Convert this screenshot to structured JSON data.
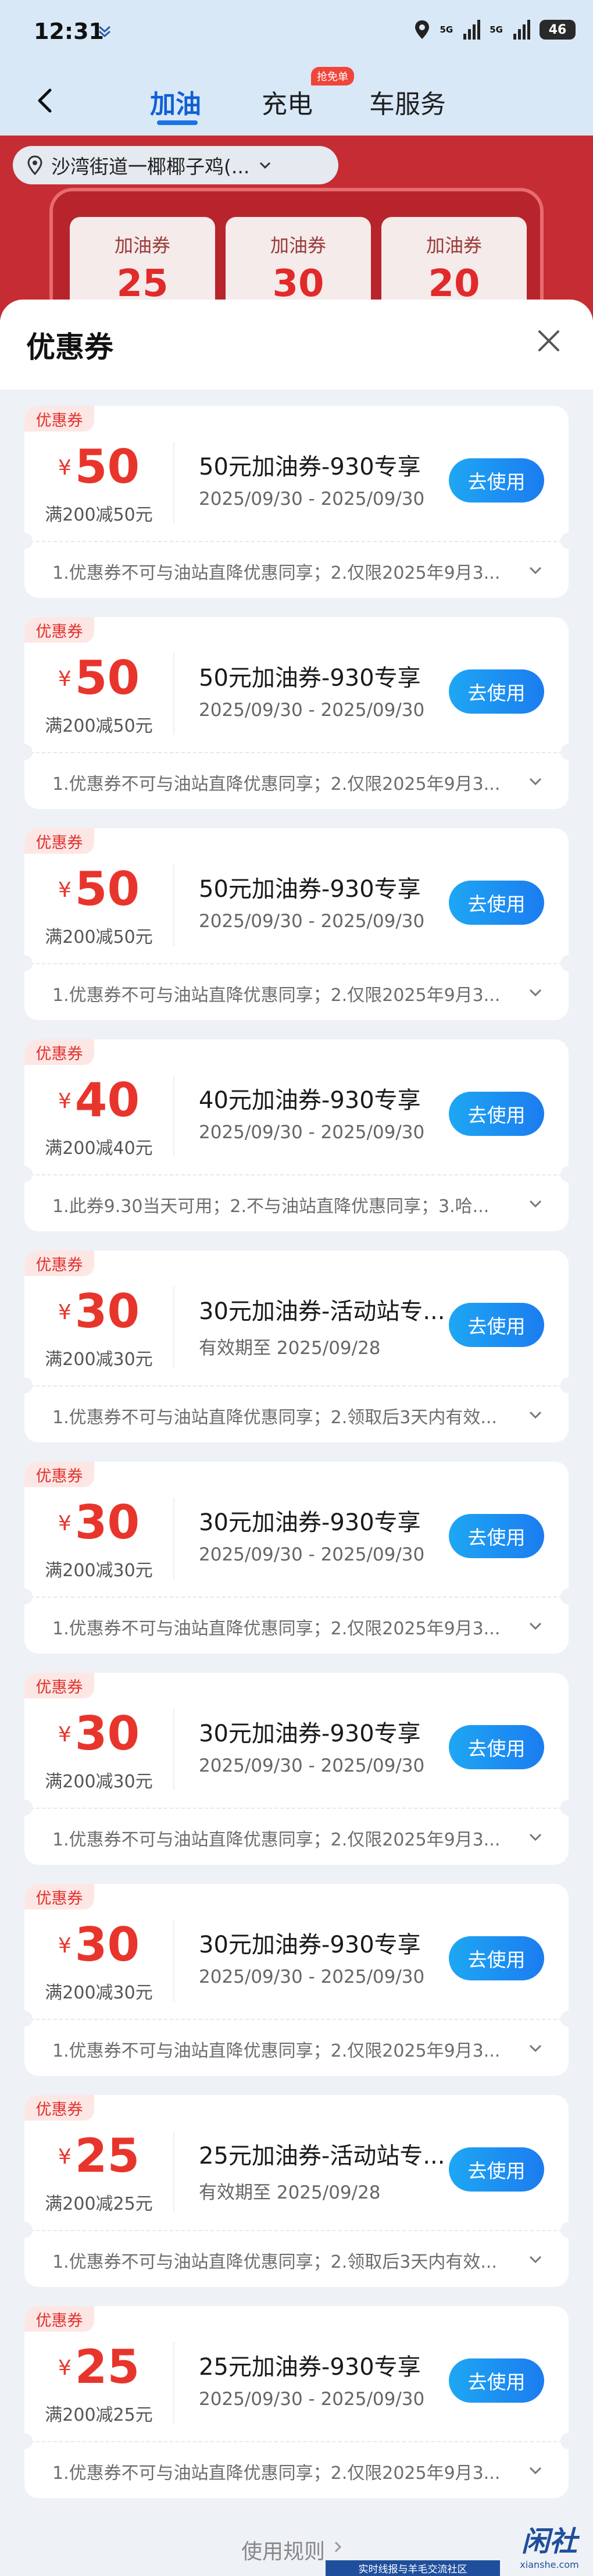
{
  "status_bar": {
    "time": "12:31",
    "signal_tag_1": "5G",
    "signal_tag_2": "5G",
    "battery": "46"
  },
  "nav": {
    "back_icon": "chevron-left-icon",
    "tabs": [
      {
        "label": "加油",
        "active": true
      },
      {
        "label": "充电",
        "badge": "抢免单"
      },
      {
        "label": "车服务"
      }
    ]
  },
  "hero": {
    "location": "沙湾街道一椰椰子鸡(...",
    "cards": [
      {
        "label": "加油券",
        "value": "25"
      },
      {
        "label": "加油券",
        "value": "30"
      },
      {
        "label": "加油券",
        "value": "20"
      }
    ]
  },
  "sheet": {
    "title": "优惠券",
    "close_icon": "close-icon"
  },
  "coupons": [
    {
      "tag": "优惠券",
      "currency": "¥",
      "amount": "50",
      "condition": "满200减50元",
      "title": "50元加油券-930专享",
      "date": "2025/09/30 - 2025/09/30",
      "button": "去使用",
      "rules": "1.优惠券不可与油站直降优惠同享；2.仅限2025年9月3..."
    },
    {
      "tag": "优惠券",
      "currency": "¥",
      "amount": "50",
      "condition": "满200减50元",
      "title": "50元加油券-930专享",
      "date": "2025/09/30 - 2025/09/30",
      "button": "去使用",
      "rules": "1.优惠券不可与油站直降优惠同享；2.仅限2025年9月3..."
    },
    {
      "tag": "优惠券",
      "currency": "¥",
      "amount": "50",
      "condition": "满200减50元",
      "title": "50元加油券-930专享",
      "date": "2025/09/30 - 2025/09/30",
      "button": "去使用",
      "rules": "1.优惠券不可与油站直降优惠同享；2.仅限2025年9月3..."
    },
    {
      "tag": "优惠券",
      "currency": "¥",
      "amount": "40",
      "condition": "满200减40元",
      "title": "40元加油券-930专享",
      "date": "2025/09/30 - 2025/09/30",
      "button": "去使用",
      "rules": "1.此券9.30当天可用；2.不与油站直降优惠同享；3.哈..."
    },
    {
      "tag": "优惠券",
      "currency": "¥",
      "amount": "30",
      "condition": "满200减30元",
      "title": "30元加油券-活动站专...",
      "date": "有效期至 2025/09/28",
      "button": "去使用",
      "rules": "1.优惠券不可与油站直降优惠同享；2.领取后3天内有效..."
    },
    {
      "tag": "优惠券",
      "currency": "¥",
      "amount": "30",
      "condition": "满200减30元",
      "title": "30元加油券-930专享",
      "date": "2025/09/30 - 2025/09/30",
      "button": "去使用",
      "rules": "1.优惠券不可与油站直降优惠同享；2.仅限2025年9月3..."
    },
    {
      "tag": "优惠券",
      "currency": "¥",
      "amount": "30",
      "condition": "满200减30元",
      "title": "30元加油券-930专享",
      "date": "2025/09/30 - 2025/09/30",
      "button": "去使用",
      "rules": "1.优惠券不可与油站直降优惠同享；2.仅限2025年9月3..."
    },
    {
      "tag": "优惠券",
      "currency": "¥",
      "amount": "30",
      "condition": "满200减30元",
      "title": "30元加油券-930专享",
      "date": "2025/09/30 - 2025/09/30",
      "button": "去使用",
      "rules": "1.优惠券不可与油站直降优惠同享；2.仅限2025年9月3..."
    },
    {
      "tag": "优惠券",
      "currency": "¥",
      "amount": "25",
      "condition": "满200减25元",
      "title": "25元加油券-活动站专...",
      "date": "有效期至 2025/09/28",
      "button": "去使用",
      "rules": "1.优惠券不可与油站直降优惠同享；2.领取后3天内有效..."
    },
    {
      "tag": "优惠券",
      "currency": "¥",
      "amount": "25",
      "condition": "满200减25元",
      "title": "25元加油券-930专享",
      "date": "2025/09/30 - 2025/09/30",
      "button": "去使用",
      "rules": "1.优惠券不可与油站直降优惠同享；2.仅限2025年9月3..."
    }
  ],
  "footer": {
    "link": "使用规则",
    "watermark_bar": "实时线报与羊毛交流社区",
    "watermark_logo": "闲社",
    "watermark_site": "xianshe.com"
  }
}
